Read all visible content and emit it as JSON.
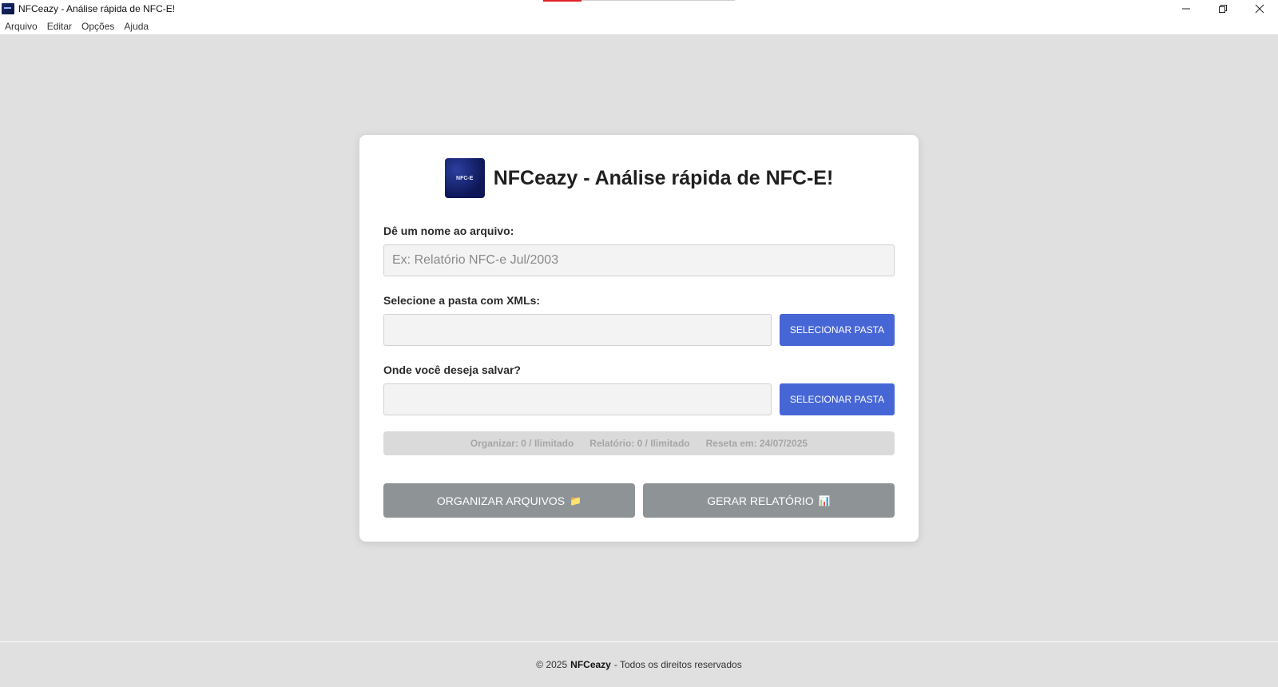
{
  "window": {
    "title": "NFCeazy - Análise rápida de NFC-E!"
  },
  "menu": {
    "items": [
      "Arquivo",
      "Editar",
      "Opções",
      "Ajuda"
    ]
  },
  "card": {
    "logo_text": "NFC-E",
    "title": "NFCeazy - Análise rápida de NFC-E!",
    "filename_label": "Dê um nome ao arquivo:",
    "filename_placeholder": "Ex: Relatório NFC-e Jul/2003",
    "filename_value": "",
    "xml_folder_label": "Selecione a pasta com XMLs:",
    "xml_folder_value": "",
    "xml_folder_button": "SELECIONAR PASTA",
    "save_label": "Onde você deseja salvar?",
    "save_value": "",
    "save_button": "SELECIONAR PASTA",
    "quota": {
      "organize": "Organizar: 0 / Ilimitado",
      "report": "Relatório: 0 / Ilimitado",
      "reset": "Reseta em: 24/07/2025"
    },
    "organize_button": "ORGANIZAR ARQUIVOS",
    "organize_icon": "📁",
    "report_button": "GERAR RELATÓRIO",
    "report_icon": "📊"
  },
  "footer": {
    "prefix": "© 2025",
    "brand": "NFCeazy",
    "suffix": "- Todos os direitos reservados"
  },
  "colors": {
    "background": "#e0e0e0",
    "primary_button": "#4766d6",
    "disabled_button": "#8e9396",
    "close_accent": "#e0202a"
  }
}
